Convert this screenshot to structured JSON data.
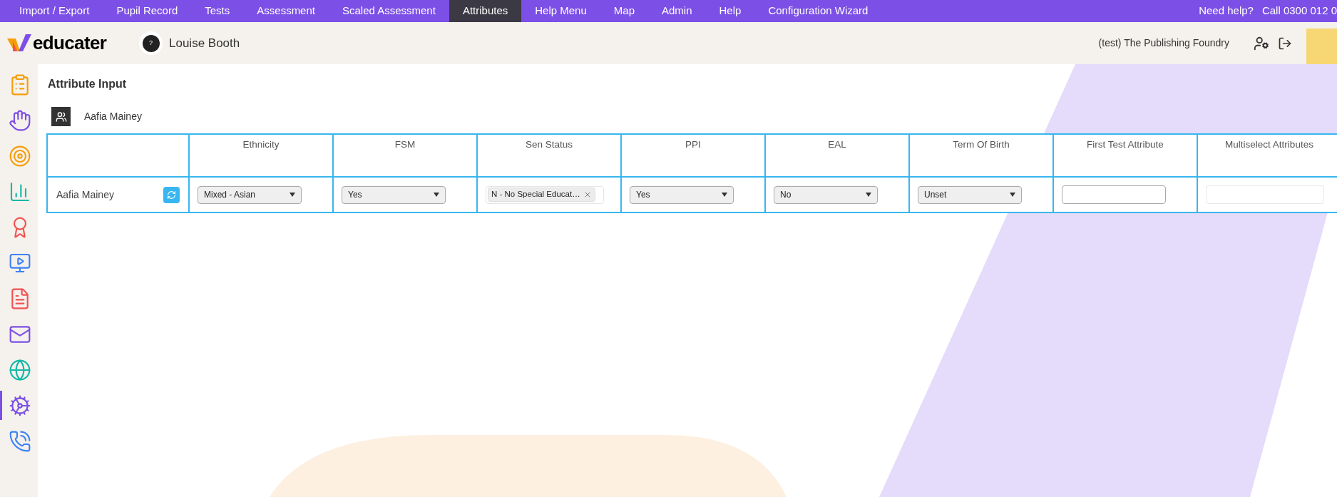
{
  "nav": {
    "tabs": [
      {
        "label": "Import / Export",
        "selected": false
      },
      {
        "label": "Pupil Record",
        "selected": false
      },
      {
        "label": "Tests",
        "selected": false
      },
      {
        "label": "Assessment",
        "selected": false
      },
      {
        "label": "Scaled Assessment",
        "selected": false
      },
      {
        "label": "Attributes",
        "selected": true
      },
      {
        "label": "Help Menu",
        "selected": false
      },
      {
        "label": "Map",
        "selected": false
      },
      {
        "label": "Admin",
        "selected": false
      },
      {
        "label": "Help",
        "selected": false
      },
      {
        "label": "Configuration Wizard",
        "selected": false
      }
    ],
    "help": "Need help?",
    "phone": "Call 0300 012 0"
  },
  "header": {
    "logo": "educater",
    "avatar_mark": "?",
    "user": "Louise Booth",
    "school": "(test) The Publishing Foundry"
  },
  "sidebar": {
    "items": [
      {
        "selected": false
      },
      {
        "selected": false
      },
      {
        "selected": false
      },
      {
        "selected": false
      },
      {
        "selected": false
      },
      {
        "selected": false
      },
      {
        "selected": false
      },
      {
        "selected": false
      },
      {
        "selected": false
      },
      {
        "selected": true
      },
      {
        "selected": false
      }
    ]
  },
  "page": {
    "title": "Attribute Input",
    "group_label": "Aafia Mainey"
  },
  "table": {
    "columns": [
      "Ethnicity",
      "FSM",
      "Sen Status",
      "PPI",
      "EAL",
      "Term Of Birth",
      "First Test Attribute",
      "Multiselect Attributes"
    ],
    "rows": [
      {
        "name": "Aafia Mainey",
        "cells": [
          {
            "kind": "select",
            "value": "Mixed - Asian"
          },
          {
            "kind": "select",
            "value": "Yes"
          },
          {
            "kind": "tag",
            "value": "N - No Special Educat…"
          },
          {
            "kind": "select",
            "value": "Yes"
          },
          {
            "kind": "select",
            "value": "No"
          },
          {
            "kind": "select",
            "value": "Unset"
          },
          {
            "kind": "input"
          },
          {
            "kind": "multiselect"
          }
        ]
      }
    ]
  }
}
